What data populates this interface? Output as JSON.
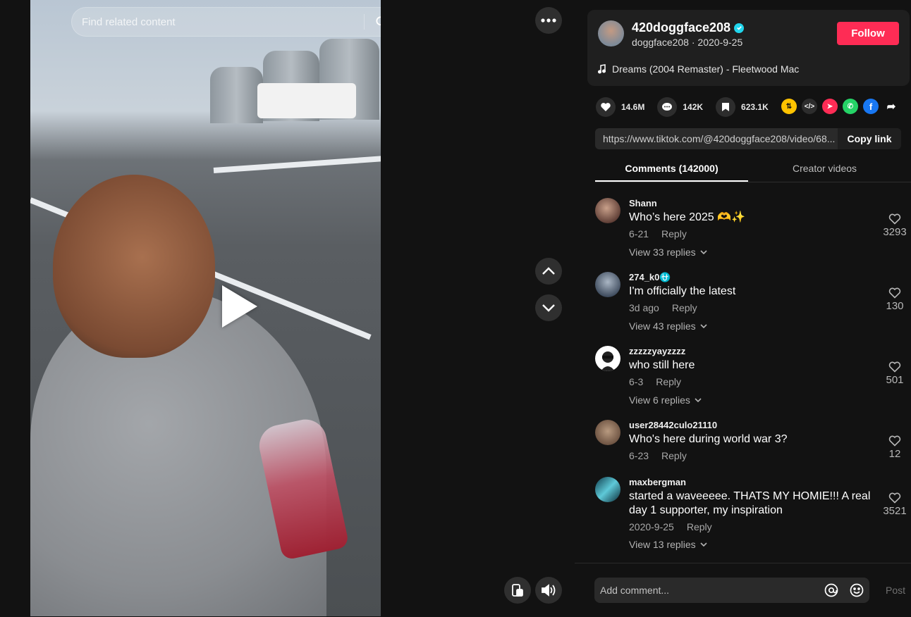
{
  "search": {
    "placeholder": "Find related content"
  },
  "author": {
    "username": "420doggface208",
    "nickname": "doggface208",
    "date": "2020-9-25",
    "verified_icon": "verified-badge-icon",
    "follow_label": "Follow",
    "music": "Dreams (2004 Remaster) - Fleetwood Mac"
  },
  "stats": {
    "likes": "14.6M",
    "comments": "142K",
    "saves": "623.1K"
  },
  "link": {
    "url": "https://www.tiktok.com/@420doggface208/video/68...",
    "copy_label": "Copy link"
  },
  "tabs": [
    {
      "label": "Comments (142000)"
    },
    {
      "label": "Creator videos"
    }
  ],
  "comments": [
    {
      "name": "Shann",
      "text": "Who’s here 2025 🫶✨",
      "date": "6-21",
      "reply": "Reply",
      "replies": "View 33 replies",
      "likes": "3293"
    },
    {
      "name": "274_k0⛎",
      "text": "I'm officially the latest",
      "date": "3d ago",
      "reply": "Reply",
      "replies": "View 43 replies",
      "likes": "130"
    },
    {
      "name": "zzzzzyayzzzz",
      "text": "who still here",
      "date": "6-3",
      "reply": "Reply",
      "replies": "View 6 replies",
      "likes": "501"
    },
    {
      "name": "user28442culo21110",
      "text": "Who's here during world war 3?",
      "date": "6-23",
      "reply": "Reply",
      "replies": "",
      "likes": "12"
    },
    {
      "name": "maxbergman",
      "text": "started a waveeeee. THATS MY HOMIE!!! A real day 1 supporter, my inspiration",
      "date": "2020-9-25",
      "reply": "Reply",
      "replies": "View 13 replies",
      "likes": "3521"
    }
  ],
  "comment_box": {
    "placeholder": "Add comment...",
    "post_label": "Post"
  },
  "colors": {
    "accent": "#fe2c55",
    "verified": "#20d5ec"
  }
}
